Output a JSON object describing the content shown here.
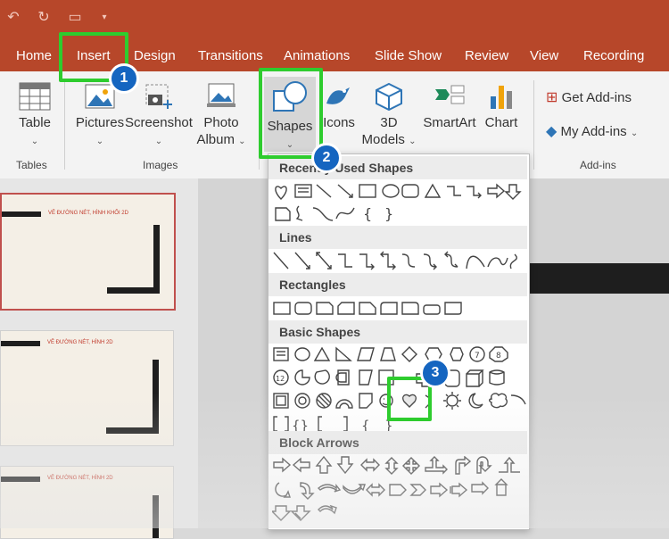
{
  "tabs": [
    "Home",
    "Insert",
    "Design",
    "Transitions",
    "Animations",
    "Slide Show",
    "Review",
    "View",
    "Recording"
  ],
  "ribbon": {
    "table": {
      "label": "Table",
      "group": "Tables"
    },
    "pictures": "Pictures",
    "screenshot": "Screenshot",
    "photo_album": [
      "Photo",
      "Album"
    ],
    "shapes": "Shapes",
    "icons": "Icons",
    "models": [
      "3D",
      "Models"
    ],
    "smartart": "SmartArt",
    "chart": "Chart",
    "images_group": "Images",
    "get_addins": "Get Add-ins",
    "my_addins": "My Add-ins",
    "addins_group": "Add-ins"
  },
  "shapes_menu": {
    "recent": "Recently Used Shapes",
    "lines": "Lines",
    "rectangles": "Rectangles",
    "basic": "Basic Shapes",
    "block_arrows": "Block Arrows",
    "braces": [
      "{",
      "}"
    ],
    "octagon_num": "8",
    "heptagon_num": "7",
    "dodecagon_num": "12"
  },
  "slides": [
    {
      "title": "VẼ ĐƯỜNG NÉT, HÌNH KHỐI 2D"
    },
    {
      "title": "VẼ ĐƯỜNG NÉT, HÌNH 2D"
    },
    {
      "title": "VẼ ĐƯỜNG NÉT, HÌNH 2D"
    }
  ],
  "callouts": [
    "1",
    "2",
    "3"
  ],
  "colors": {
    "accent": "#b7472a",
    "highlight": "#2ecc2e",
    "badge": "#1565c0"
  }
}
